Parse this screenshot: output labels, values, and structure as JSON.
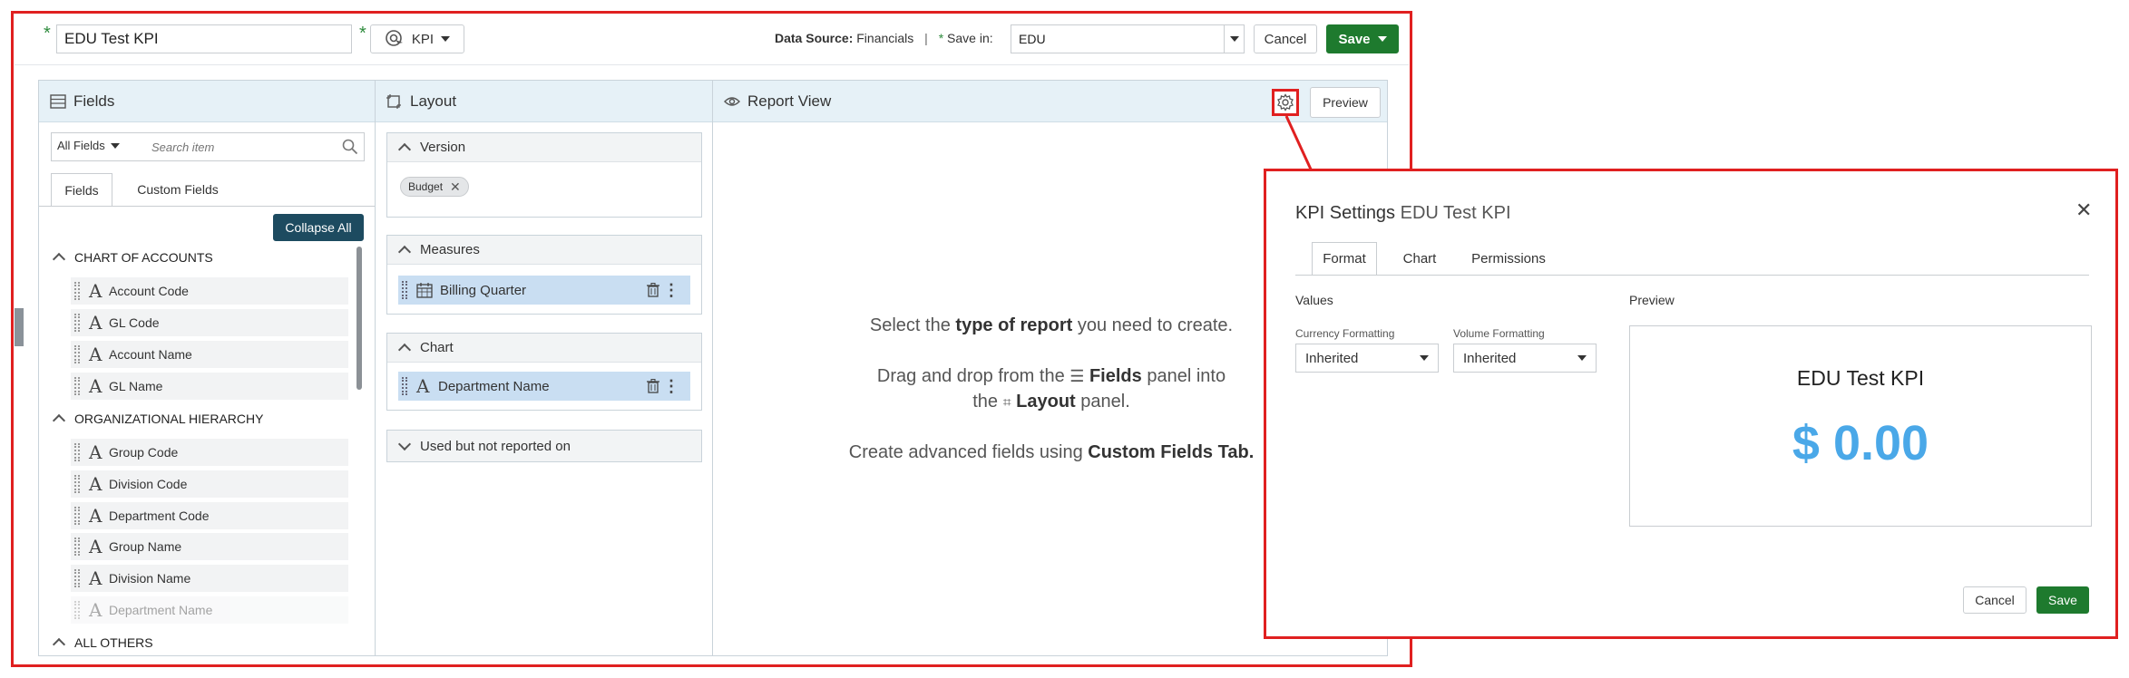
{
  "topbar": {
    "kpi_name_value": "EDU Test KPI",
    "type_label": "KPI",
    "data_source_label": "Data Source:",
    "data_source_value": "Financials",
    "separator": "|",
    "save_in_label": "Save in:",
    "save_in_value": "EDU",
    "cancel_label": "Cancel",
    "save_label": "Save"
  },
  "fields_panel": {
    "title": "Fields",
    "filter_value": "All Fields",
    "search_placeholder": "Search item",
    "tabs": [
      "Fields",
      "Custom Fields"
    ],
    "collapse_all_label": "Collapse All",
    "sections": [
      {
        "title": "CHART OF ACCOUNTS",
        "items": [
          "Account Code",
          "GL Code",
          "Account Name",
          "GL Name"
        ]
      },
      {
        "title": "ORGANIZATIONAL HIERARCHY",
        "items": [
          "Group Code",
          "Division Code",
          "Department Code",
          "Group Name",
          "Division Name",
          "Department Name"
        ]
      },
      {
        "title": "ALL OTHERS",
        "items": []
      }
    ]
  },
  "layout_panel": {
    "title": "Layout",
    "version": {
      "title": "Version",
      "chip": "Budget"
    },
    "measures": {
      "title": "Measures",
      "item": "Billing Quarter"
    },
    "chart": {
      "title": "Chart",
      "item": "Department Name"
    },
    "unused": {
      "title": "Used but not reported on"
    }
  },
  "report_view": {
    "title": "Report View",
    "preview_label": "Preview",
    "line1_pre": "Select the",
    "line1_bold": "type of report",
    "line1_post": "you need to create.",
    "line2_pre": "Drag and drop from the",
    "line2_bold1": "Fields",
    "line2_mid": "panel into",
    "line3_pre": "the",
    "line3_bold": "Layout",
    "line3_post": "panel.",
    "line4_pre": "Create advanced fields using",
    "line4_bold": "Custom Fields Tab."
  },
  "modal": {
    "title_prefix": "KPI Settings",
    "title_name": "EDU Test KPI",
    "tabs": [
      "Format",
      "Chart",
      "Permissions"
    ],
    "values_label": "Values",
    "currency_label": "Currency Formatting",
    "currency_value": "Inherited",
    "volume_label": "Volume Formatting",
    "volume_value": "Inherited",
    "preview_label": "Preview",
    "preview_title": "EDU Test KPI",
    "preview_value": "$ 0.00",
    "cancel_label": "Cancel",
    "save_label": "Save"
  },
  "colors": {
    "highlight": "#e02020",
    "save_green": "#1e7a2e",
    "kpi_value_blue": "#4aa8e8",
    "panel_header": "#e6f1f7",
    "layout_item": "#c9def2"
  }
}
